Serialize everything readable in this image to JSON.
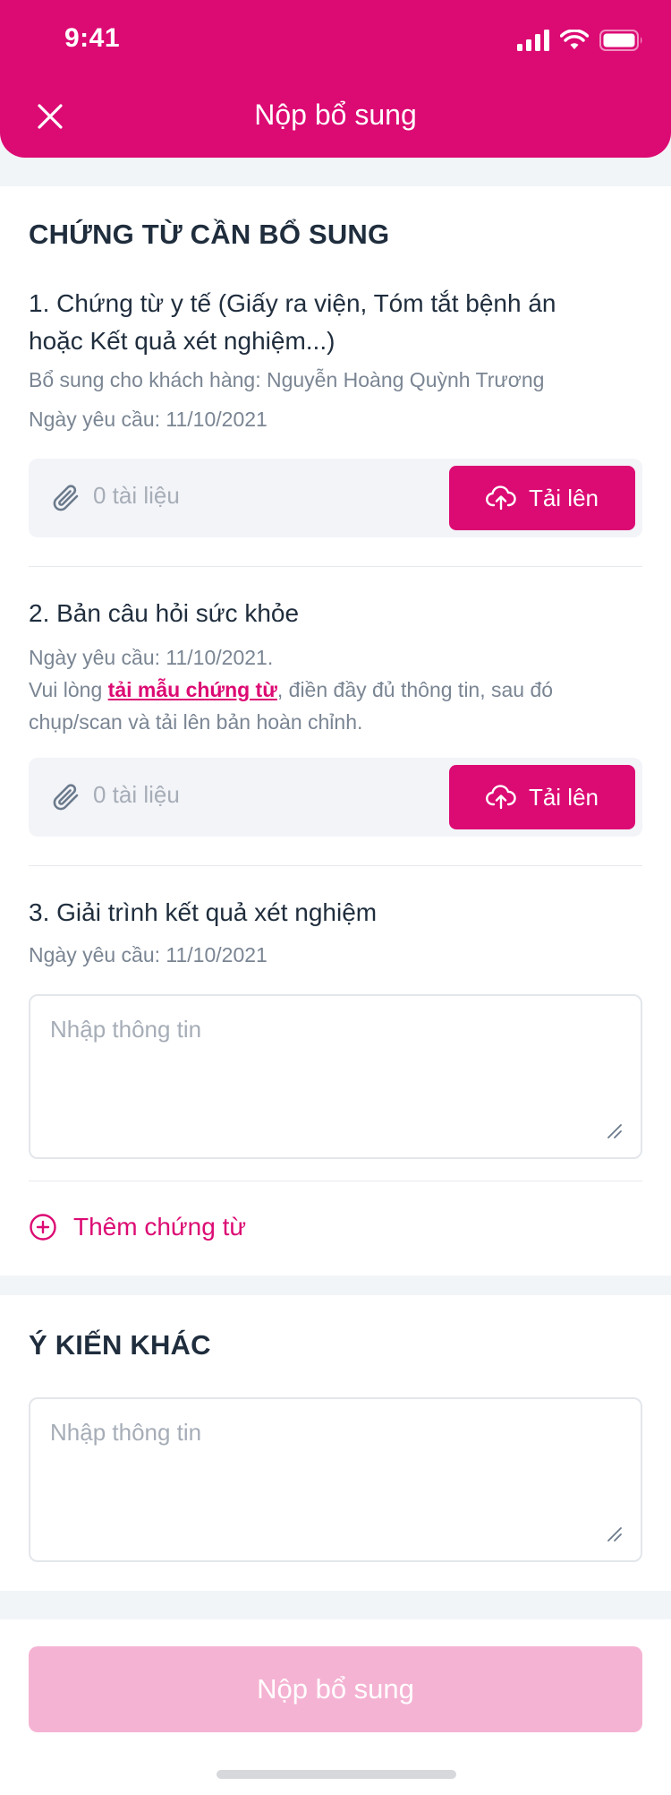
{
  "status_bar": {
    "time": "9:41"
  },
  "header": {
    "title": "Nộp bổ sung"
  },
  "documents": {
    "section_title": "CHỨNG TỪ CẦN BỔ SUNG",
    "item1": {
      "title": "1. Chứng từ y tế (Giấy ra viện, Tóm tắt bệnh án hoặc Kết quả xét nghiệm...)",
      "customer": "Bổ sung cho khách hàng: Nguyễn Hoàng Quỳnh Trương",
      "date": "Ngày yêu cầu: 11/10/2021",
      "doc_count": "0 tài liệu",
      "upload_label": "Tải lên"
    },
    "item2": {
      "title": "2. Bản câu hỏi sức khỏe",
      "date": "Ngày yêu cầu: 11/10/2021.",
      "instruction_prefix": "Vui lòng ",
      "instruction_link": "tải mẫu chứng từ",
      "instruction_suffix": ", điền đầy đủ thông tin, sau đó chụp/scan và tải lên bản hoàn chỉnh.",
      "doc_count": "0 tài liệu",
      "upload_label": "Tải lên"
    },
    "item3": {
      "title": "3. Giải trình kết quả xét nghiệm",
      "date": "Ngày yêu cầu: 11/10/2021",
      "placeholder": "Nhập thông tin"
    },
    "add_label": "Thêm chứng từ"
  },
  "other": {
    "section_title": "Ý KIẾN KHÁC",
    "placeholder": "Nhập thông tin"
  },
  "footer": {
    "submit_label": "Nộp bổ sung"
  },
  "colors": {
    "brand": "#dc0a73",
    "disabled_button": "#f5b3d3",
    "page_bg": "#f2f5f8"
  },
  "icons": [
    "close-icon",
    "signal-icon",
    "wifi-icon",
    "battery-icon",
    "paperclip-icon",
    "cloud-upload-icon",
    "plus-circle-icon",
    "resize-handle-icon"
  ]
}
